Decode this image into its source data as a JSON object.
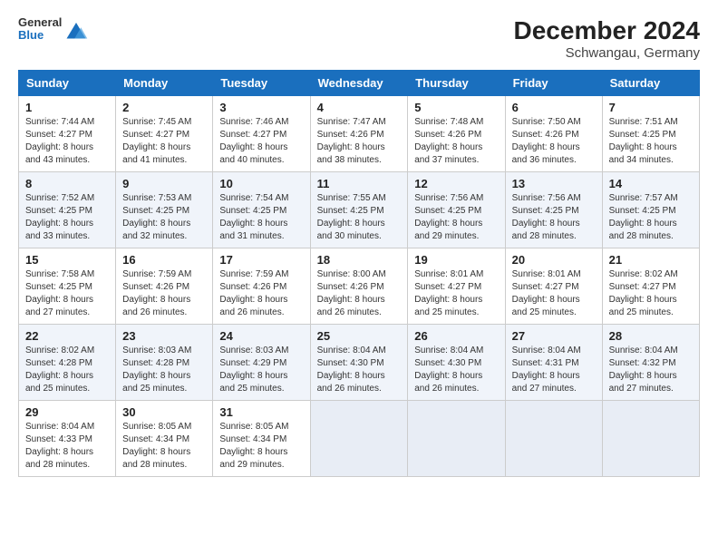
{
  "logo": {
    "line1": "General",
    "line2": "Blue"
  },
  "title": "December 2024",
  "subtitle": "Schwangau, Germany",
  "days_of_week": [
    "Sunday",
    "Monday",
    "Tuesday",
    "Wednesday",
    "Thursday",
    "Friday",
    "Saturday"
  ],
  "weeks": [
    [
      {
        "day": 1,
        "sunrise": "7:44 AM",
        "sunset": "4:27 PM",
        "daylight": "8 hours and 43 minutes."
      },
      {
        "day": 2,
        "sunrise": "7:45 AM",
        "sunset": "4:27 PM",
        "daylight": "8 hours and 41 minutes."
      },
      {
        "day": 3,
        "sunrise": "7:46 AM",
        "sunset": "4:27 PM",
        "daylight": "8 hours and 40 minutes."
      },
      {
        "day": 4,
        "sunrise": "7:47 AM",
        "sunset": "4:26 PM",
        "daylight": "8 hours and 38 minutes."
      },
      {
        "day": 5,
        "sunrise": "7:48 AM",
        "sunset": "4:26 PM",
        "daylight": "8 hours and 37 minutes."
      },
      {
        "day": 6,
        "sunrise": "7:50 AM",
        "sunset": "4:26 PM",
        "daylight": "8 hours and 36 minutes."
      },
      {
        "day": 7,
        "sunrise": "7:51 AM",
        "sunset": "4:25 PM",
        "daylight": "8 hours and 34 minutes."
      }
    ],
    [
      {
        "day": 8,
        "sunrise": "7:52 AM",
        "sunset": "4:25 PM",
        "daylight": "8 hours and 33 minutes."
      },
      {
        "day": 9,
        "sunrise": "7:53 AM",
        "sunset": "4:25 PM",
        "daylight": "8 hours and 32 minutes."
      },
      {
        "day": 10,
        "sunrise": "7:54 AM",
        "sunset": "4:25 PM",
        "daylight": "8 hours and 31 minutes."
      },
      {
        "day": 11,
        "sunrise": "7:55 AM",
        "sunset": "4:25 PM",
        "daylight": "8 hours and 30 minutes."
      },
      {
        "day": 12,
        "sunrise": "7:56 AM",
        "sunset": "4:25 PM",
        "daylight": "8 hours and 29 minutes."
      },
      {
        "day": 13,
        "sunrise": "7:56 AM",
        "sunset": "4:25 PM",
        "daylight": "8 hours and 28 minutes."
      },
      {
        "day": 14,
        "sunrise": "7:57 AM",
        "sunset": "4:25 PM",
        "daylight": "8 hours and 28 minutes."
      }
    ],
    [
      {
        "day": 15,
        "sunrise": "7:58 AM",
        "sunset": "4:25 PM",
        "daylight": "8 hours and 27 minutes."
      },
      {
        "day": 16,
        "sunrise": "7:59 AM",
        "sunset": "4:26 PM",
        "daylight": "8 hours and 26 minutes."
      },
      {
        "day": 17,
        "sunrise": "7:59 AM",
        "sunset": "4:26 PM",
        "daylight": "8 hours and 26 minutes."
      },
      {
        "day": 18,
        "sunrise": "8:00 AM",
        "sunset": "4:26 PM",
        "daylight": "8 hours and 26 minutes."
      },
      {
        "day": 19,
        "sunrise": "8:01 AM",
        "sunset": "4:27 PM",
        "daylight": "8 hours and 25 minutes."
      },
      {
        "day": 20,
        "sunrise": "8:01 AM",
        "sunset": "4:27 PM",
        "daylight": "8 hours and 25 minutes."
      },
      {
        "day": 21,
        "sunrise": "8:02 AM",
        "sunset": "4:27 PM",
        "daylight": "8 hours and 25 minutes."
      }
    ],
    [
      {
        "day": 22,
        "sunrise": "8:02 AM",
        "sunset": "4:28 PM",
        "daylight": "8 hours and 25 minutes."
      },
      {
        "day": 23,
        "sunrise": "8:03 AM",
        "sunset": "4:28 PM",
        "daylight": "8 hours and 25 minutes."
      },
      {
        "day": 24,
        "sunrise": "8:03 AM",
        "sunset": "4:29 PM",
        "daylight": "8 hours and 25 minutes."
      },
      {
        "day": 25,
        "sunrise": "8:04 AM",
        "sunset": "4:30 PM",
        "daylight": "8 hours and 26 minutes."
      },
      {
        "day": 26,
        "sunrise": "8:04 AM",
        "sunset": "4:30 PM",
        "daylight": "8 hours and 26 minutes."
      },
      {
        "day": 27,
        "sunrise": "8:04 AM",
        "sunset": "4:31 PM",
        "daylight": "8 hours and 27 minutes."
      },
      {
        "day": 28,
        "sunrise": "8:04 AM",
        "sunset": "4:32 PM",
        "daylight": "8 hours and 27 minutes."
      }
    ],
    [
      {
        "day": 29,
        "sunrise": "8:04 AM",
        "sunset": "4:33 PM",
        "daylight": "8 hours and 28 minutes."
      },
      {
        "day": 30,
        "sunrise": "8:05 AM",
        "sunset": "4:34 PM",
        "daylight": "8 hours and 28 minutes."
      },
      {
        "day": 31,
        "sunrise": "8:05 AM",
        "sunset": "4:34 PM",
        "daylight": "8 hours and 29 minutes."
      },
      null,
      null,
      null,
      null
    ]
  ],
  "labels": {
    "sunrise": "Sunrise:",
    "sunset": "Sunset:",
    "daylight": "Daylight:"
  }
}
